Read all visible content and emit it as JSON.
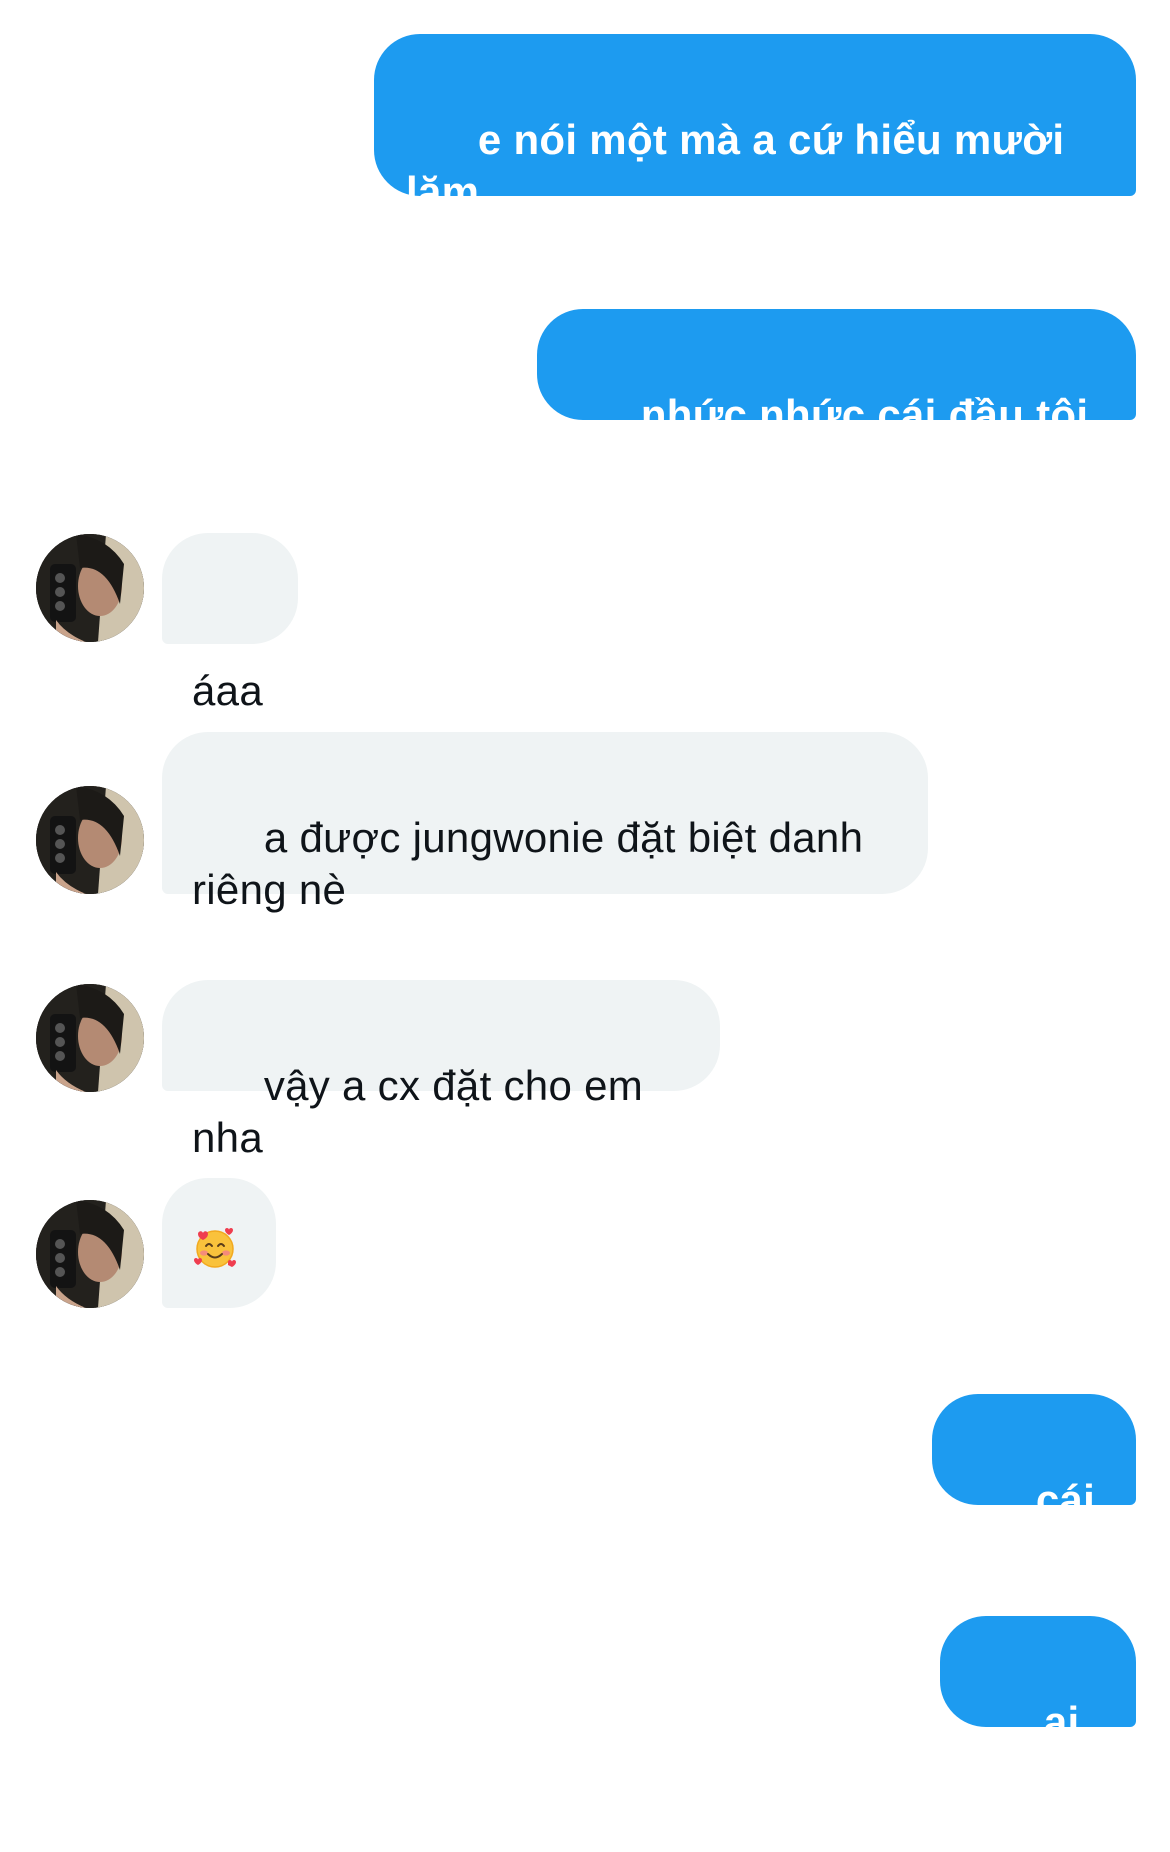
{
  "thread": {
    "messages": [
      {
        "direction": "out",
        "text": "e nói một mà a cứ hiểu mười lăm\nlận á",
        "meta": ""
      },
      {
        "direction": "out",
        "text": "nhức nhức cái đầu tôi luôn",
        "meta": ""
      },
      {
        "direction": "in",
        "text": "áaa",
        "meta": ""
      },
      {
        "direction": "in",
        "text": "a được jungwonie đặt biệt danh\nriêng nè",
        "meta": ""
      },
      {
        "direction": "in",
        "text": "vậy a cx đặt cho em nha",
        "meta": ""
      },
      {
        "direction": "in",
        "emoji": "smiling-face-with-hearts",
        "text": "",
        "meta": ""
      },
      {
        "direction": "out",
        "text": "cái gì z",
        "meta": ""
      },
      {
        "direction": "out",
        "text": "ai cho",
        "meta": ""
      }
    ]
  },
  "colors": {
    "outgoing_bubble": "#1d9bf0",
    "outgoing_text": "#ffffff",
    "incoming_bubble": "#eff3f4",
    "incoming_text": "#0f1419",
    "background": "#ffffff"
  }
}
